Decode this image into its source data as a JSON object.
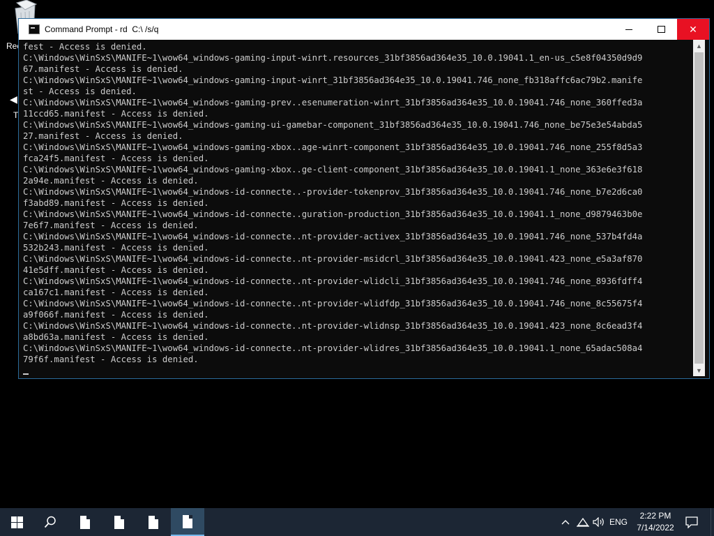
{
  "desktop": {
    "icons": [
      {
        "label": "Rec",
        "icon": "recycle-bin-icon"
      },
      {
        "label": "T",
        "icon": "arrow-left-icon"
      }
    ]
  },
  "window": {
    "title": "Command Prompt - rd  C:\\ /s/q",
    "icon": "cmd-icon",
    "buttons": {
      "minimize": "minimize-icon",
      "maximize": "maximize-icon",
      "close": "✕"
    }
  },
  "console": {
    "lines": [
      "fest - Access is denied.",
      "C:\\Windows\\WinSxS\\MANIFE~1\\wow64_windows-gaming-input-winrt.resources_31bf3856ad364e35_10.0.19041.1_en-us_c5e8f04350d9d9",
      "67.manifest - Access is denied.",
      "C:\\Windows\\WinSxS\\MANIFE~1\\wow64_windows-gaming-input-winrt_31bf3856ad364e35_10.0.19041.746_none_fb318affc6ac79b2.manife",
      "st - Access is denied.",
      "C:\\Windows\\WinSxS\\MANIFE~1\\wow64_windows-gaming-prev..esenumeration-winrt_31bf3856ad364e35_10.0.19041.746_none_360ffed3a",
      "11ccd65.manifest - Access is denied.",
      "C:\\Windows\\WinSxS\\MANIFE~1\\wow64_windows-gaming-ui-gamebar-component_31bf3856ad364e35_10.0.19041.746_none_be75e3e54abda5",
      "27.manifest - Access is denied.",
      "C:\\Windows\\WinSxS\\MANIFE~1\\wow64_windows-gaming-xbox..age-winrt-component_31bf3856ad364e35_10.0.19041.746_none_255f8d5a3",
      "fca24f5.manifest - Access is denied.",
      "C:\\Windows\\WinSxS\\MANIFE~1\\wow64_windows-gaming-xbox..ge-client-component_31bf3856ad364e35_10.0.19041.1_none_363e6e3f618",
      "2a94e.manifest - Access is denied.",
      "C:\\Windows\\WinSxS\\MANIFE~1\\wow64_windows-id-connecte..-provider-tokenprov_31bf3856ad364e35_10.0.19041.746_none_b7e2d6ca0",
      "f3abd89.manifest - Access is denied.",
      "C:\\Windows\\WinSxS\\MANIFE~1\\wow64_windows-id-connecte..guration-production_31bf3856ad364e35_10.0.19041.1_none_d9879463b0e",
      "7e6f7.manifest - Access is denied.",
      "C:\\Windows\\WinSxS\\MANIFE~1\\wow64_windows-id-connecte..nt-provider-activex_31bf3856ad364e35_10.0.19041.746_none_537b4fd4a",
      "532b243.manifest - Access is denied.",
      "C:\\Windows\\WinSxS\\MANIFE~1\\wow64_windows-id-connecte..nt-provider-msidcrl_31bf3856ad364e35_10.0.19041.423_none_e5a3af870",
      "41e5dff.manifest - Access is denied.",
      "C:\\Windows\\WinSxS\\MANIFE~1\\wow64_windows-id-connecte..nt-provider-wlidcli_31bf3856ad364e35_10.0.19041.746_none_8936fdff4",
      "ca167c1.manifest - Access is denied.",
      "C:\\Windows\\WinSxS\\MANIFE~1\\wow64_windows-id-connecte..nt-provider-wlidfdp_31bf3856ad364e35_10.0.19041.746_none_8c55675f4",
      "a9f066f.manifest - Access is denied.",
      "C:\\Windows\\WinSxS\\MANIFE~1\\wow64_windows-id-connecte..nt-provider-wlidnsp_31bf3856ad364e35_10.0.19041.423_none_8c6ead3f4",
      "a8bd63a.manifest - Access is denied.",
      "C:\\Windows\\WinSxS\\MANIFE~1\\wow64_windows-id-connecte..nt-provider-wlidres_31bf3856ad364e35_10.0.19041.1_none_65adac508a4",
      "79f6f.manifest - Access is denied."
    ]
  },
  "taskbar": {
    "start_icon": "windows-logo-icon",
    "search_icon": "search-icon",
    "apps": [
      {
        "icon": "document-icon",
        "active": false
      },
      {
        "icon": "document-icon",
        "active": false
      },
      {
        "icon": "document-icon",
        "active": false
      },
      {
        "icon": "document-icon",
        "active": true
      }
    ],
    "tray": {
      "chevron_icon": "chevron-up-icon",
      "network_icon": "network-icon",
      "volume_icon": "volume-icon",
      "language": "ENG",
      "time": "2:22 PM",
      "date": "7/14/2022",
      "notification_icon": "notification-icon"
    }
  }
}
